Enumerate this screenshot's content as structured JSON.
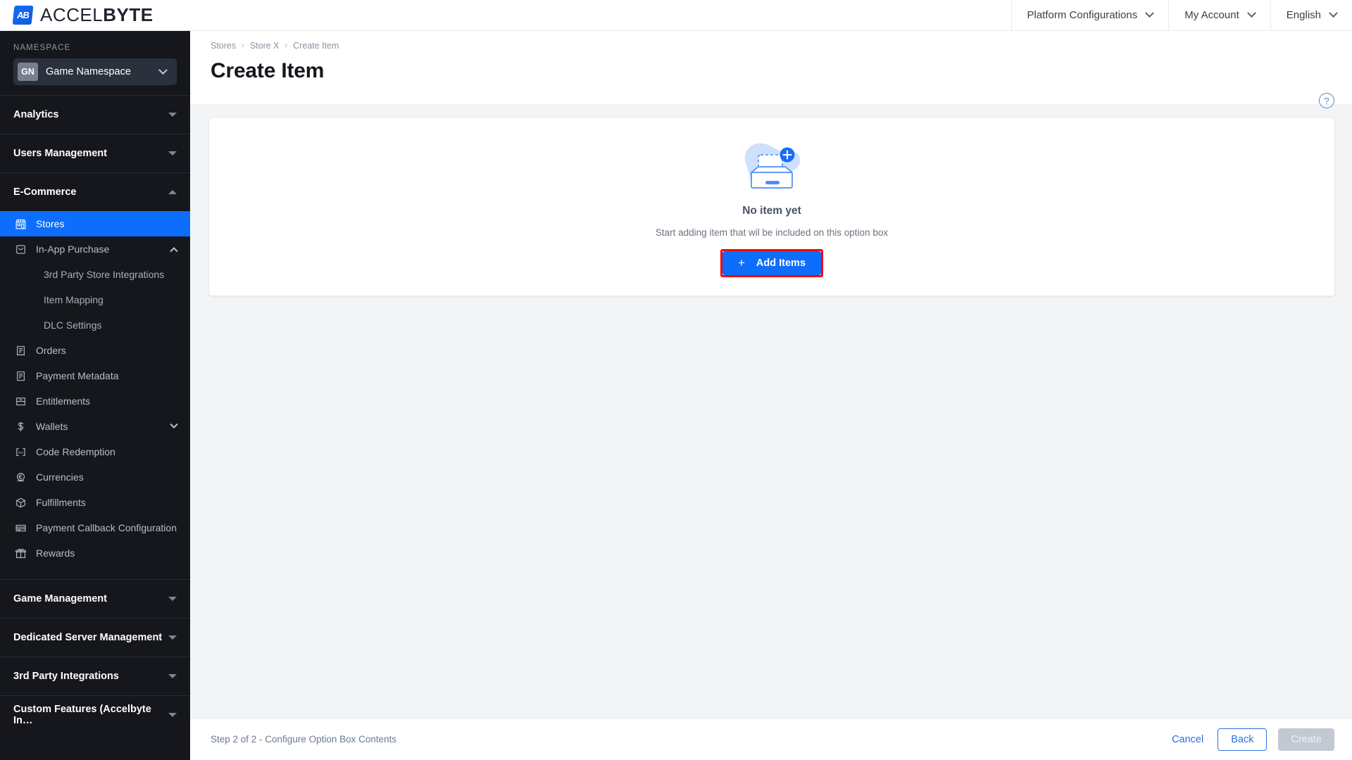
{
  "brand": {
    "mark": "AB",
    "name_light": "ACCEL",
    "name_bold": "BYTE"
  },
  "topnav": [
    {
      "label": "Platform Configurations",
      "icon": "chevron-down-icon"
    },
    {
      "label": "My Account",
      "icon": "chevron-down-icon"
    },
    {
      "label": "English",
      "icon": "chevron-down-icon"
    }
  ],
  "sidebar": {
    "namespace_label": "NAMESPACE",
    "namespace_initials": "GN",
    "namespace_name": "Game Namespace",
    "groups": [
      {
        "label": "Analytics",
        "state": "collapsed"
      },
      {
        "label": "Users Management",
        "state": "collapsed"
      },
      {
        "label": "E-Commerce",
        "state": "expanded"
      }
    ],
    "ecommerce_items": [
      {
        "label": "Stores",
        "icon": "storefront-icon",
        "active": true
      },
      {
        "label": "In-App Purchase",
        "icon": "bag-icon",
        "active": false,
        "expandable": true,
        "expanded": true
      },
      {
        "label": "3rd Party Store Integrations",
        "sub": true
      },
      {
        "label": "Item Mapping",
        "sub": true
      },
      {
        "label": "DLC Settings",
        "sub": true
      },
      {
        "label": "Orders",
        "icon": "receipt-icon",
        "active": false
      },
      {
        "label": "Payment Metadata",
        "icon": "document-icon",
        "active": false
      },
      {
        "label": "Entitlements",
        "icon": "card-icon",
        "active": false
      },
      {
        "label": "Wallets",
        "icon": "dollar-icon",
        "active": false,
        "expandable": true,
        "expanded": false
      },
      {
        "label": "Code Redemption",
        "icon": "code-icon",
        "active": false
      },
      {
        "label": "Currencies",
        "icon": "coin-icon",
        "active": false
      },
      {
        "label": "Fulfillments",
        "icon": "box-icon",
        "active": false
      },
      {
        "label": "Payment Callback Configuration",
        "icon": "payment-card-icon",
        "active": false
      },
      {
        "label": "Rewards",
        "icon": "gift-icon",
        "active": false
      }
    ],
    "bottom_groups": [
      {
        "label": "Game Management",
        "state": "collapsed"
      },
      {
        "label": "Dedicated Server Management",
        "state": "collapsed"
      },
      {
        "label": "3rd Party Integrations",
        "state": "collapsed"
      },
      {
        "label": "Custom Features (Accelbyte In…",
        "state": "collapsed"
      }
    ]
  },
  "page": {
    "breadcrumb": [
      "Stores",
      "Store X",
      "Create Item"
    ],
    "breadcrumb_separator": "›",
    "title": "Create Item",
    "help_icon": "question-mark-icon",
    "help_glyph": "?"
  },
  "empty_state": {
    "illustration": "empty-inbox-add-icon",
    "title": "No item yet",
    "subtitle": "Start adding item that wil be included on this option box",
    "button_label": "Add Items",
    "button_plus": "+",
    "highlight_color": "#ff0000",
    "button_color": "#0d6efd"
  },
  "footer": {
    "step_text": "Step 2 of 2 - Configure Option Box Contents",
    "cancel_label": "Cancel",
    "back_label": "Back",
    "create_label": "Create"
  }
}
